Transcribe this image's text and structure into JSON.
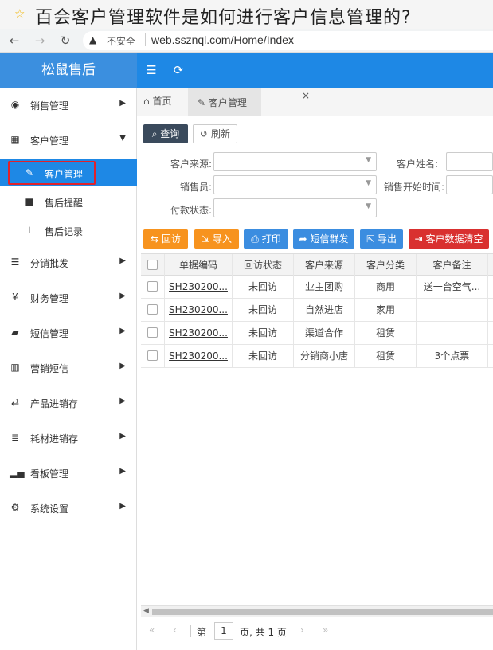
{
  "overlay": {
    "title": "百会客户管理软件是如何进行客户信息管理的?",
    "star_icon": "star-icon"
  },
  "browser": {
    "insecure_label": "不安全",
    "url": "web.ssznql.com/Home/Index"
  },
  "app": {
    "brand": "松鼠售后"
  },
  "sidebar": {
    "items": [
      {
        "label": "销售管理",
        "icon": "user-circle-icon"
      },
      {
        "label": "客户管理",
        "icon": "calendar-icon"
      },
      {
        "label": "客户管理",
        "icon": "edit-icon",
        "sub": true,
        "active": true
      },
      {
        "label": "售后提醒",
        "icon": "file-icon",
        "sub": true
      },
      {
        "label": "售后记录",
        "icon": "sitemap-icon",
        "sub": true
      },
      {
        "label": "分销批发",
        "icon": "list-icon"
      },
      {
        "label": "财务管理",
        "icon": "yen-icon"
      },
      {
        "label": "短信管理",
        "icon": "book-icon"
      },
      {
        "label": "营销短信",
        "icon": "open-book-icon"
      },
      {
        "label": "产品进销存",
        "icon": "exchange-icon"
      },
      {
        "label": "耗材进销存",
        "icon": "list-ul-icon"
      },
      {
        "label": "看板管理",
        "icon": "bar-chart-icon"
      },
      {
        "label": "系统设置",
        "icon": "cogs-icon"
      }
    ]
  },
  "tabs": {
    "home": "首页",
    "active": "客户管理",
    "close": "×"
  },
  "toolbar": {
    "query": "查询",
    "reset": "刷新"
  },
  "filters": {
    "source_label": "客户来源:",
    "name_label": "客户姓名:",
    "sales_label": "销售员:",
    "sale_start_label": "销售开始时间:",
    "payment_label": "付款状态:"
  },
  "actions": {
    "revisit": "回访",
    "import": "导入",
    "print": "打印",
    "sms": "短信群发",
    "export": "导出",
    "clear": "客户数据清空"
  },
  "table": {
    "headers": [
      "单据编码",
      "回访状态",
      "客户来源",
      "客户分类",
      "客户备注"
    ],
    "rows": [
      [
        "SH230200...",
        "未回访",
        "业主团购",
        "商用",
        "送一台空气..."
      ],
      [
        "SH230200...",
        "未回访",
        "自然进店",
        "家用",
        ""
      ],
      [
        "SH230200...",
        "未回访",
        "渠道合作",
        "租赁",
        ""
      ],
      [
        "SH230200...",
        "未回访",
        "分销商小唐",
        "租赁",
        "3个点票"
      ]
    ]
  },
  "pager": {
    "page_prefix": "第",
    "page_value": "1",
    "page_suffix": "页, 共 1 页"
  },
  "colors": {
    "primary": "#1e88e5",
    "orange": "#f7931e",
    "red": "#d9302f",
    "dark": "#3a4a5c"
  }
}
